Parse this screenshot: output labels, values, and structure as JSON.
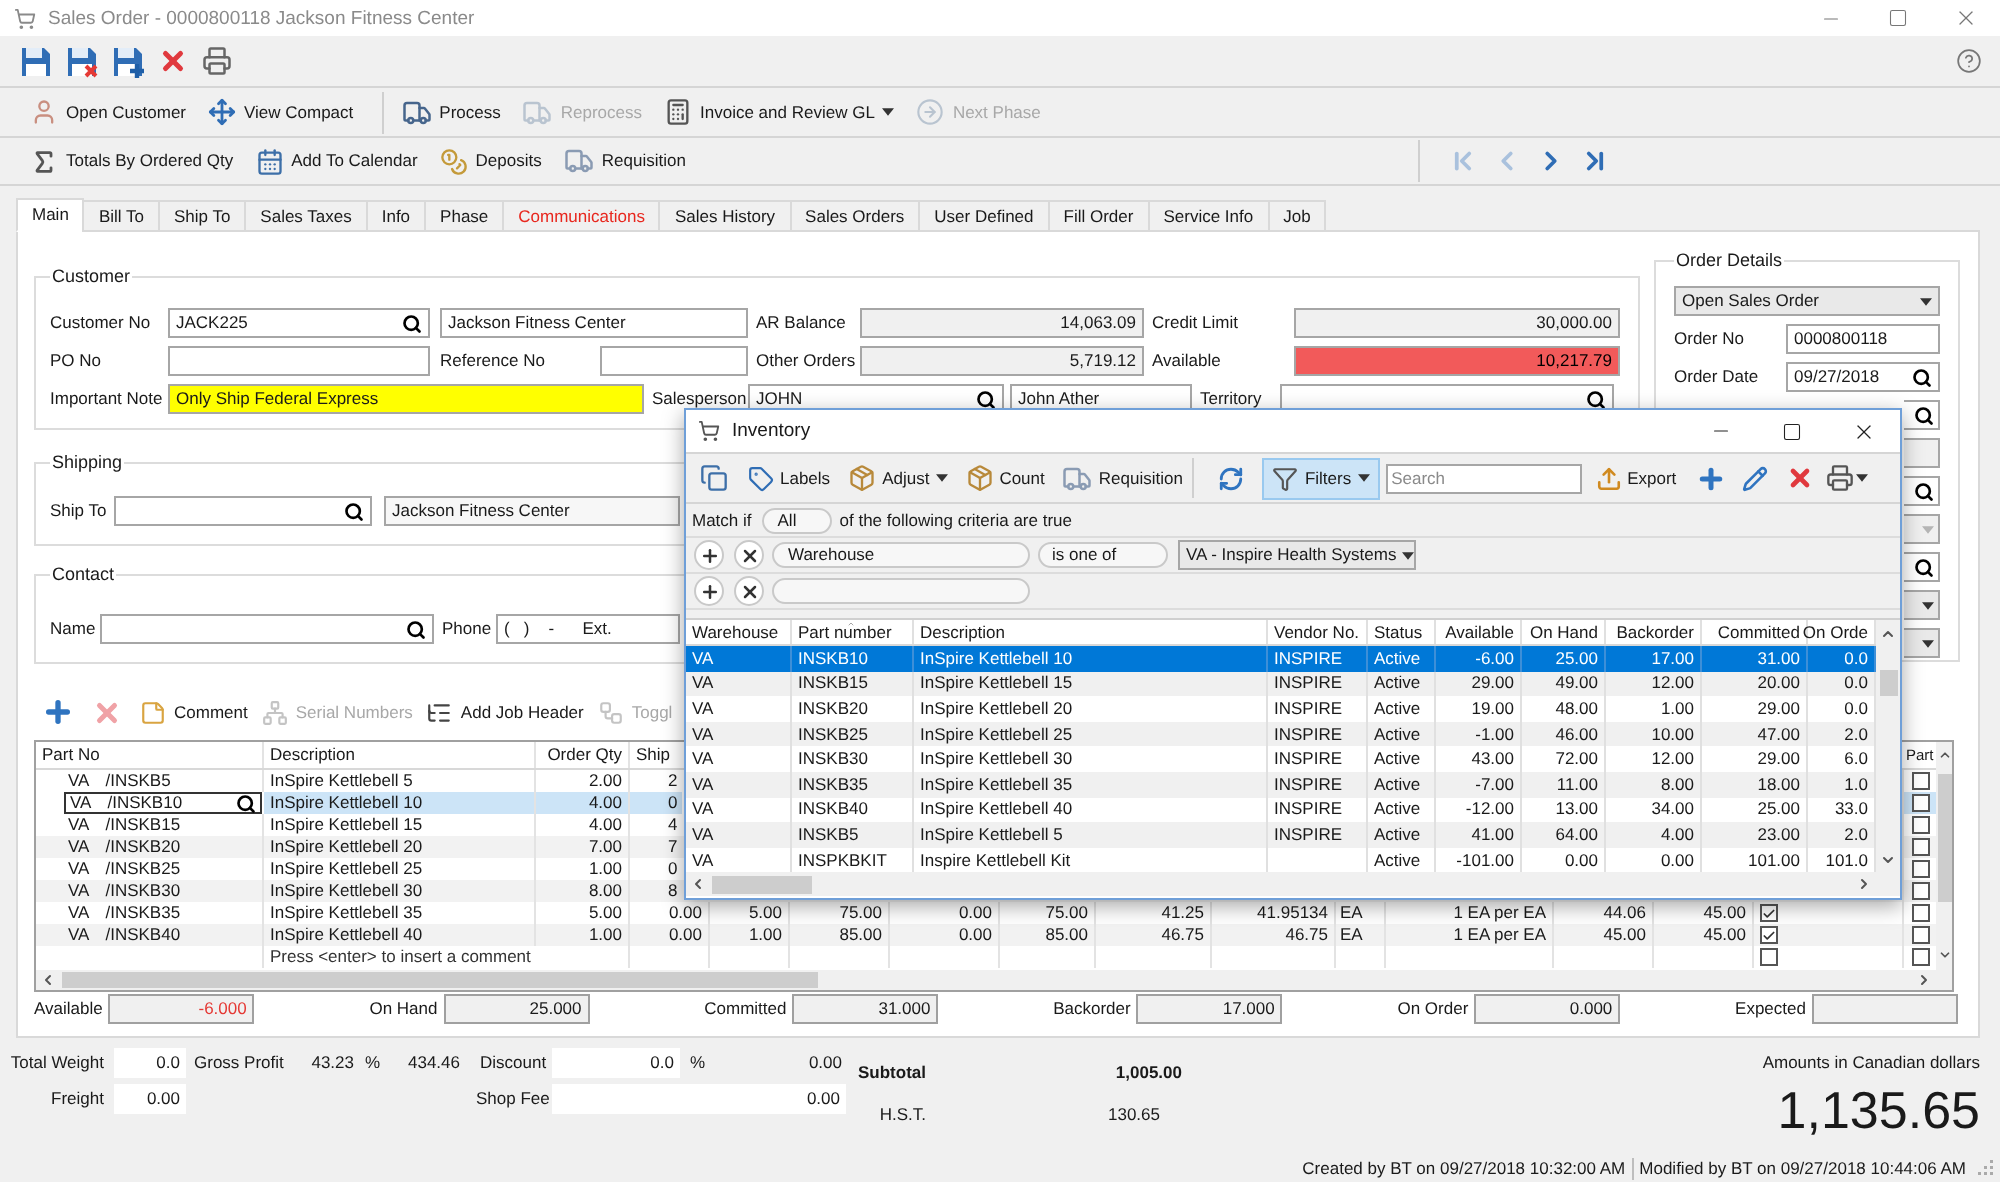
{
  "window": {
    "title": "Sales Order - 0000800118 Jackson Fitness Center"
  },
  "toolbar_2": [
    {
      "items": [
        {
          "label": "Open Customer",
          "kind": "button",
          "disabled": false
        },
        {
          "label": "View Compact",
          "kind": "button",
          "disabled": false
        }
      ]
    },
    {
      "items": [
        {
          "label": "Process",
          "kind": "button",
          "disabled": false
        },
        {
          "label": "Reprocess",
          "kind": "button",
          "disabled": true
        },
        {
          "label": "Invoice and Review GL",
          "kind": "menu",
          "disabled": false
        },
        {
          "label": "Next Phase",
          "kind": "button",
          "disabled": true
        }
      ]
    }
  ],
  "toolbar_3": {
    "items": [
      {
        "label": "Totals By Ordered Qty"
      },
      {
        "label": "Add To Calendar"
      },
      {
        "label": "Deposits"
      },
      {
        "label": "Requisition"
      }
    ],
    "navigation": [
      {
        "disabled": true
      },
      {
        "disabled": true
      },
      {
        "disabled": false
      },
      {
        "disabled": false
      }
    ]
  },
  "tabs": [
    {
      "label": "Main",
      "selected": true,
      "flagged": false
    },
    {
      "label": "Bill To",
      "selected": false,
      "flagged": false
    },
    {
      "label": "Ship To",
      "selected": false,
      "flagged": false
    },
    {
      "label": "Sales Taxes",
      "selected": false,
      "flagged": false
    },
    {
      "label": "Info",
      "selected": false,
      "flagged": false
    },
    {
      "label": "Phase",
      "selected": false,
      "flagged": false
    },
    {
      "label": "Communications",
      "selected": false,
      "flagged": true
    },
    {
      "label": "Sales History",
      "selected": false,
      "flagged": false
    },
    {
      "label": "Sales Orders",
      "selected": false,
      "flagged": false
    },
    {
      "label": "User Defined",
      "selected": false,
      "flagged": false
    },
    {
      "label": "Fill Order",
      "selected": false,
      "flagged": false
    },
    {
      "label": "Service Info",
      "selected": false,
      "flagged": false
    },
    {
      "label": "Job",
      "selected": false,
      "flagged": false
    }
  ],
  "customer": {
    "title": "Customer",
    "customer_no": {
      "label": "Customer No",
      "value": "JACK225"
    },
    "customer_name": {
      "value": "Jackson Fitness Center"
    },
    "ar_balance": {
      "label": "AR Balance",
      "value": "14,063.09",
      "readonly": true
    },
    "credit_limit": {
      "label": "Credit Limit",
      "value": "30,000.00",
      "readonly": true
    },
    "po_no": {
      "label": "PO No"
    },
    "reference_no": {
      "label": "Reference No"
    },
    "other_orders": {
      "label": "Other Orders",
      "value": "5,719.12",
      "readonly": true
    },
    "available": {
      "label": "Available",
      "value": "10,217.79",
      "over_limit": true
    },
    "important_note": {
      "label": "Important Note",
      "value": "Only Ship Federal Express",
      "highlighted": true
    },
    "salesperson": {
      "label": "Salesperson",
      "value": "JOHN"
    },
    "salesperson_name": {
      "value": "John Ather"
    },
    "territory": {
      "label": "Territory"
    }
  },
  "order_details": {
    "title": "Order Details",
    "status": "Open Sales Order",
    "order_no": {
      "label": "Order No",
      "value": "0000800118"
    },
    "order_date": {
      "label": "Order Date",
      "value": "09/27/2018"
    },
    "more_fields": [
      {
        "kind": "lookup",
        "disabled": false
      },
      {
        "kind": "text",
        "disabled": true
      },
      {
        "kind": "lookup",
        "disabled": false
      },
      {
        "kind": "dropdown",
        "disabled": true
      },
      {
        "kind": "lookup",
        "disabled": false
      },
      {
        "kind": "dropdown",
        "disabled": false
      },
      {
        "kind": "dropdown",
        "disabled": false
      }
    ]
  },
  "shipping": {
    "title": "Shipping",
    "ship_to": {
      "label": "Ship To"
    },
    "ship_to_name": {
      "value": "Jackson Fitness Center"
    }
  },
  "contact": {
    "title": "Contact",
    "name": {
      "label": "Name"
    },
    "phone": {
      "label": "Phone",
      "value": "(   )    -      Ext."
    }
  },
  "line_toolbar": {
    "add": {
      "disabled": false
    },
    "remove": {
      "disabled": true
    },
    "actions": [
      {
        "label": "Comment",
        "disabled": false
      },
      {
        "label": "Serial Numbers",
        "disabled": true
      },
      {
        "label": "Add Job Header",
        "disabled": false
      },
      {
        "label": "Toggl",
        "disabled": true
      }
    ]
  },
  "lines": {
    "columns": [
      "Part No",
      "Description",
      "Order Qty",
      "Ship"
    ],
    "last_column": "Part",
    "rows": [
      {
        "kind": "item",
        "warehouse": "VA",
        "part_no": "/INSKB5",
        "description": "InSpire Kettlebell 5",
        "order_qty": "2.00",
        "ship_qty": "2",
        "selected": false,
        "part": false
      },
      {
        "kind": "item",
        "warehouse": "VA",
        "part_no": "/INSKB10",
        "description": "InSpire Kettlebell 10",
        "order_qty": "4.00",
        "ship_qty": "0",
        "selected": true,
        "part": false
      },
      {
        "kind": "item",
        "warehouse": "VA",
        "part_no": "/INSKB15",
        "description": "InSpire Kettlebell 15",
        "order_qty": "4.00",
        "ship_qty": "4",
        "selected": false,
        "part": false
      },
      {
        "kind": "item",
        "warehouse": "VA",
        "part_no": "/INSKB20",
        "description": "InSpire Kettlebell 20",
        "order_qty": "7.00",
        "ship_qty": "7",
        "selected": false,
        "part": false
      },
      {
        "kind": "item",
        "warehouse": "VA",
        "part_no": "/INSKB25",
        "description": "InSpire Kettlebell 25",
        "order_qty": "1.00",
        "ship_qty": "0",
        "selected": false,
        "part": false
      },
      {
        "kind": "item",
        "warehouse": "VA",
        "part_no": "/INSKB30",
        "description": "InSpire Kettlebell 30",
        "order_qty": "8.00",
        "ship_qty": "8",
        "selected": false,
        "part": false
      },
      {
        "kind": "item",
        "warehouse": "VA",
        "part_no": "/INSKB35",
        "description": "InSpire Kettlebell 35",
        "order_qty": "5.00",
        "ship_qty": "0.00",
        "other_cells": [
          "5.00",
          "75.00",
          "0.00",
          "75.00",
          "41.25",
          "41.95134",
          "EA",
          "1 EA per EA",
          "44.06",
          "45.00"
        ],
        "checked": true,
        "selected": false,
        "part": false
      },
      {
        "kind": "item",
        "warehouse": "VA",
        "part_no": "/INSKB40",
        "description": "InSpire Kettlebell 40",
        "order_qty": "1.00",
        "ship_qty": "0.00",
        "other_cells": [
          "1.00",
          "85.00",
          "0.00",
          "85.00",
          "46.75",
          "46.75",
          "EA",
          "1 EA per EA",
          "45.00",
          "45.00"
        ],
        "checked": true,
        "selected": false,
        "part": false
      },
      {
        "kind": "comment",
        "text": "Press <enter> to insert a comment",
        "checked": false,
        "selected": false,
        "part": false
      }
    ]
  },
  "stock": [
    {
      "label": "Available",
      "value": "-6.000",
      "negative": true
    },
    {
      "label": "On Hand",
      "value": "25.000",
      "negative": false
    },
    {
      "label": "Committed",
      "value": "31.000",
      "negative": false
    },
    {
      "label": "Backorder",
      "value": "17.000",
      "negative": false
    },
    {
      "label": "On Order",
      "value": "0.000",
      "negative": false
    },
    {
      "label": "Expected"
    }
  ],
  "totals": {
    "total_weight": {
      "label": "Total Weight",
      "value": "0.0"
    },
    "freight": {
      "label": "Freight",
      "value": "0.00"
    },
    "gross_profit": {
      "label": "Gross Profit",
      "percent": "43.23",
      "percent_sign": "%",
      "amount": "434.46"
    },
    "discount": {
      "label": "Discount",
      "value": "0.0",
      "percent_sign": "%",
      "amount": "0.00"
    },
    "shop_fee": {
      "label": "Shop Fee",
      "value": "0.00"
    },
    "subtotal": {
      "label": "Subtotal",
      "value": "1,005.00"
    },
    "tax": {
      "label": "H.S.T.",
      "value": "130.65"
    },
    "currency_note": "Amounts in Canadian dollars",
    "total": "1,135.65"
  },
  "status_bar": {
    "created": "Created by BT on 09/27/2018 10:32:00 AM",
    "modified": "Modified by BT on 09/27/2018 10:44:06 AM"
  },
  "inventory": {
    "title": "Inventory",
    "toolbar": {
      "items": [
        {
          "label": "Labels",
          "kind": "button"
        },
        {
          "label": "Adjust",
          "kind": "menu"
        },
        {
          "label": "Count",
          "kind": "button"
        },
        {
          "label": "Requisition",
          "kind": "button"
        }
      ],
      "filters": {
        "label": "Filters",
        "pressed": true
      },
      "search": {
        "placeholder": "Search"
      },
      "export": {
        "label": "Export"
      }
    },
    "match": {
      "prefix": "Match if",
      "mode": "All",
      "suffix": "of the following criteria are true"
    },
    "criteria": [
      {
        "kind": "condition",
        "field": "Warehouse",
        "operator": "is one of",
        "value": "VA - Inspire Health Systems"
      },
      {
        "kind": "empty"
      }
    ],
    "columns": [
      {
        "label": "Warehouse",
        "sorted": false
      },
      {
        "label": "Part number",
        "sorted": true
      },
      {
        "label": "Description",
        "sorted": false
      },
      {
        "label": "Vendor No.",
        "sorted": false
      },
      {
        "label": "Status",
        "sorted": false
      },
      {
        "label": "Available",
        "sorted": false
      },
      {
        "label": "On Hand",
        "sorted": false
      },
      {
        "label": "Backorder",
        "sorted": false
      },
      {
        "label": "Committed",
        "sorted": false
      },
      {
        "label": "On Orde",
        "sorted": false
      }
    ],
    "rows": [
      {
        "warehouse": "VA",
        "part_number": "INSKB10",
        "description": "InSpire Kettlebell 10",
        "vendor_no": "INSPIRE",
        "status": "Active",
        "available": "-6.00",
        "on_hand": "25.00",
        "backorder": "17.00",
        "committed": "31.00",
        "on_order": "0.0",
        "selected": true
      },
      {
        "warehouse": "VA",
        "part_number": "INSKB15",
        "description": "InSpire Kettlebell 15",
        "vendor_no": "INSPIRE",
        "status": "Active",
        "available": "29.00",
        "on_hand": "49.00",
        "backorder": "12.00",
        "committed": "20.00",
        "on_order": "0.0",
        "selected": false
      },
      {
        "warehouse": "VA",
        "part_number": "INSKB20",
        "description": "InSpire Kettlebell 20",
        "vendor_no": "INSPIRE",
        "status": "Active",
        "available": "19.00",
        "on_hand": "48.00",
        "backorder": "1.00",
        "committed": "29.00",
        "on_order": "0.0",
        "selected": false
      },
      {
        "warehouse": "VA",
        "part_number": "INSKB25",
        "description": "InSpire Kettlebell 25",
        "vendor_no": "INSPIRE",
        "status": "Active",
        "available": "-1.00",
        "on_hand": "46.00",
        "backorder": "10.00",
        "committed": "47.00",
        "on_order": "2.0",
        "selected": false
      },
      {
        "warehouse": "VA",
        "part_number": "INSKB30",
        "description": "InSpire Kettlebell 30",
        "vendor_no": "INSPIRE",
        "status": "Active",
        "available": "43.00",
        "on_hand": "72.00",
        "backorder": "12.00",
        "committed": "29.00",
        "on_order": "6.0",
        "selected": false
      },
      {
        "warehouse": "VA",
        "part_number": "INSKB35",
        "description": "InSpire Kettlebell 35",
        "vendor_no": "INSPIRE",
        "status": "Active",
        "available": "-7.00",
        "on_hand": "11.00",
        "backorder": "8.00",
        "committed": "18.00",
        "on_order": "1.0",
        "selected": false
      },
      {
        "warehouse": "VA",
        "part_number": "INSKB40",
        "description": "InSpire Kettlebell 40",
        "vendor_no": "INSPIRE",
        "status": "Active",
        "available": "-12.00",
        "on_hand": "13.00",
        "backorder": "34.00",
        "committed": "25.00",
        "on_order": "33.0",
        "selected": false
      },
      {
        "warehouse": "VA",
        "part_number": "INSKB5",
        "description": "InSpire Kettlebell 5",
        "vendor_no": "INSPIRE",
        "status": "Active",
        "available": "41.00",
        "on_hand": "64.00",
        "backorder": "4.00",
        "committed": "23.00",
        "on_order": "2.0",
        "selected": false
      },
      {
        "warehouse": "VA",
        "part_number": "INSPKBKIT",
        "description": "Inspire Kettlebell Kit",
        "status": "Active",
        "available": "-101.00",
        "on_hand": "0.00",
        "backorder": "0.00",
        "committed": "101.00",
        "on_order": "101.0",
        "selected": false
      }
    ]
  }
}
